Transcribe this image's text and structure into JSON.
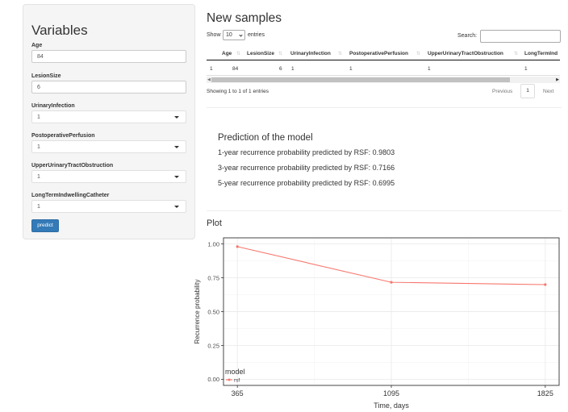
{
  "sidebar": {
    "title": "Variables",
    "fields": [
      {
        "label": "Age",
        "value": "84",
        "kind": "input"
      },
      {
        "label": "LesionSize",
        "value": "6",
        "kind": "input"
      },
      {
        "label": "UrinaryInfection",
        "value": "1",
        "kind": "select"
      },
      {
        "label": "PostoperativePerfusion",
        "value": "1",
        "kind": "select"
      },
      {
        "label": "UpperUrinaryTractObstruction",
        "value": "1",
        "kind": "select"
      },
      {
        "label": "LongTermIndwellingCatheter",
        "value": "1",
        "kind": "select"
      }
    ],
    "predict_label": "predict"
  },
  "table": {
    "title": "New samples",
    "show_label": "Show",
    "page_length": "10",
    "entries_label": "entries",
    "search_label": "Search:",
    "columns": [
      "",
      "Age",
      "LesionSize",
      "UrinaryInfection",
      "PostoperativePerfusion",
      "UpperUrinaryTractObstruction",
      "LongTermInd"
    ],
    "rows": [
      [
        "1",
        "84",
        "6",
        "1",
        "1",
        "1",
        "1"
      ]
    ],
    "info": "Showing 1 to 1 of 1 entries",
    "previous": "Previous",
    "current_page": "1",
    "next": "Next"
  },
  "prediction": {
    "title": "Prediction of the model",
    "lines": [
      "1-year recurrence probability predicted by RSF: 0.9803",
      "3-year recurrence probability predicted by RSF: 0.7166",
      "5-year recurrence probability predicted by RSF: 0.6995"
    ]
  },
  "plot": {
    "title": "Plot",
    "colors": {
      "line": "#f8766d",
      "panel_border": "#333333",
      "grid": "#ebebeb"
    }
  },
  "chart_data": {
    "type": "line",
    "x": [
      365,
      1095,
      1825
    ],
    "series": [
      {
        "name": "rsf",
        "values": [
          0.9803,
          0.7166,
          0.6995
        ]
      }
    ],
    "xlabel": "Time, days",
    "ylabel": "Recurrence probability",
    "x_ticks": [
      "365",
      "1095",
      "1825"
    ],
    "y_ticks": [
      "0.00",
      "0.25",
      "0.50",
      "0.75",
      "1.00"
    ],
    "xlim": [
      365,
      1825
    ],
    "ylim": [
      0,
      1
    ],
    "legend_title": "model",
    "legend_position": "bottom-left",
    "grid": true
  }
}
